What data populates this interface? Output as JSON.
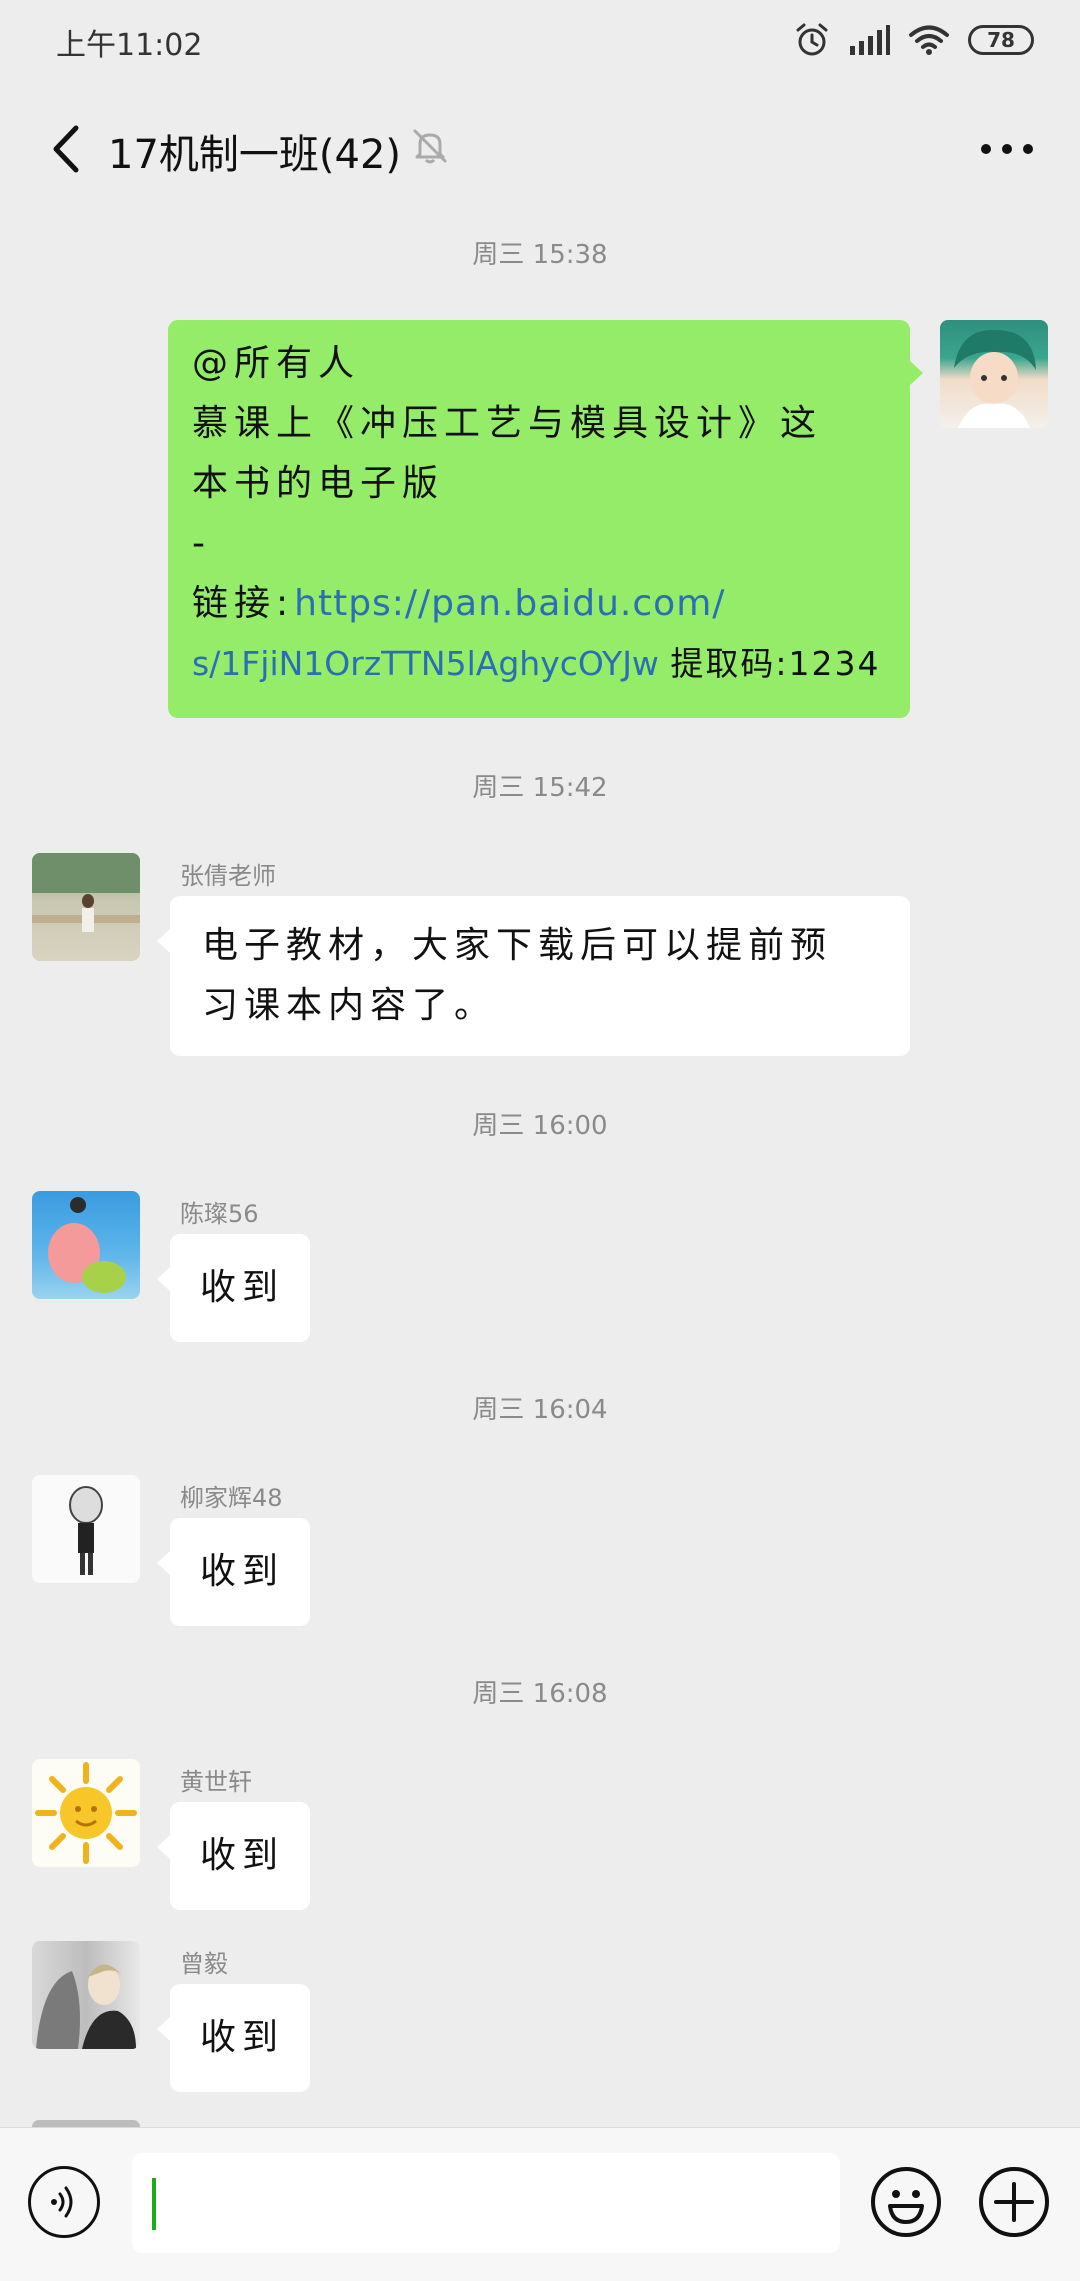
{
  "status": {
    "time": "上午11:02",
    "battery": "78"
  },
  "nav": {
    "title": "17机制一班(42)"
  },
  "messages": [
    {
      "time": "周三 15:38"
    },
    {
      "mine": true,
      "line1": "@所有人",
      "line2": "慕课上《冲压工艺与模具设计》这",
      "line3": "本书的电子版",
      "line4": "-",
      "link_label": "链接:",
      "link_part1": "https://pan.baidu.com/",
      "link_part2": "s/1FjiN1OrzTTN5lAghycOYJw",
      "code_text": "提取码:1234"
    },
    {
      "time": "周三 15:42"
    },
    {
      "sender": "张倩老师",
      "text_line1": "电子教材，大家下载后可以提前预",
      "text_line2": "习课本内容了。"
    },
    {
      "time": "周三 16:00"
    },
    {
      "sender": "陈璨56",
      "text": "收到"
    },
    {
      "time": "周三 16:04"
    },
    {
      "sender": "柳家辉48",
      "text": "收到"
    },
    {
      "time": "周三 16:08"
    },
    {
      "sender": "黄世轩",
      "text": "收到"
    },
    {
      "sender": "曾毅",
      "text": "收到"
    }
  ],
  "icons": {
    "back": "chevron-left-icon",
    "mute": "bell-off-icon",
    "more": "more-dots-icon",
    "voice": "voice-icon",
    "emoji": "emoji-icon",
    "plus": "plus-icon",
    "alarm": "alarm-icon",
    "signal": "signal-icon",
    "wifi": "wifi-icon"
  },
  "colors": {
    "background": "#ededed",
    "green_bubble": "#95ec69",
    "link": "#2a6fb4"
  }
}
